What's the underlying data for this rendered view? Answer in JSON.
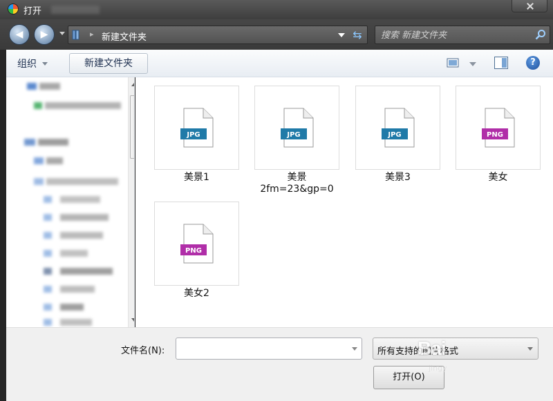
{
  "window": {
    "title": "打开"
  },
  "address": {
    "path": "新建文件夹",
    "separator": "▸"
  },
  "search": {
    "placeholder": "搜索 新建文件夹"
  },
  "toolbar": {
    "organize_label": "组织",
    "new_folder_label": "新建文件夹",
    "help_label": "?"
  },
  "files": [
    {
      "name": "美景1",
      "type": "JPG"
    },
    {
      "name": "美景\n2fm=23&gp=0",
      "type": "JPG"
    },
    {
      "name": "美景3",
      "type": "JPG"
    },
    {
      "name": "美女",
      "type": "PNG"
    },
    {
      "name": "美女2",
      "type": "PNG"
    }
  ],
  "bottom": {
    "filename_label": "文件名(N):",
    "filename_value": "",
    "filter_value": "所有支持的图片格式",
    "open_label": "打开(O)"
  },
  "colors": {
    "jpg_badge": "#1f7aa8",
    "png_badge": "#b02ea8"
  },
  "watermark": {
    "text": "Bai",
    "sub": "jingy"
  }
}
